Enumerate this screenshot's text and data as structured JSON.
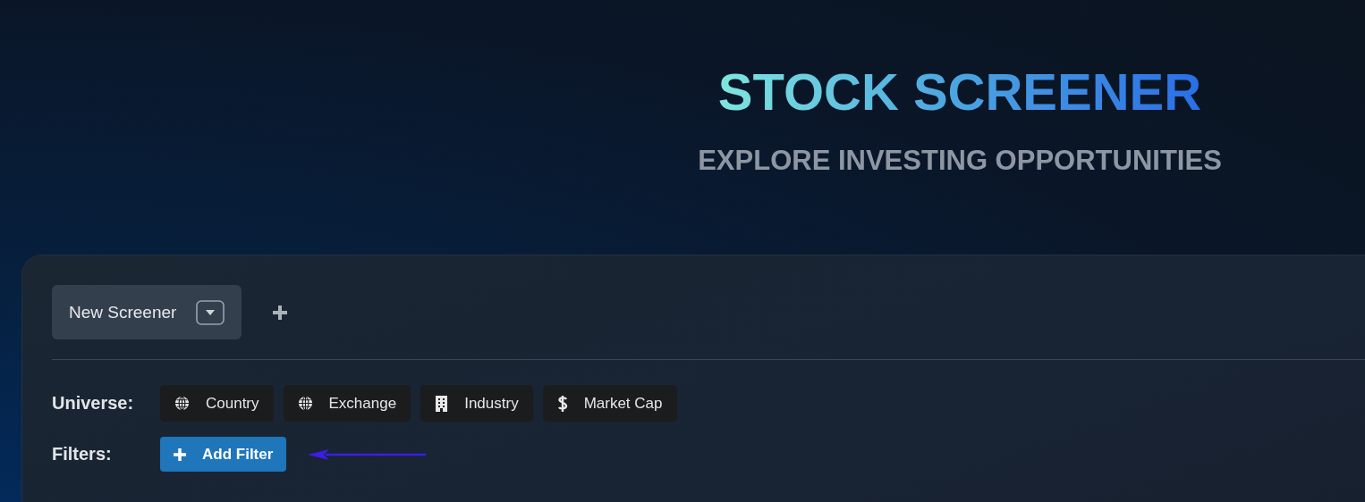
{
  "header": {
    "title": "STOCK SCREENER",
    "subtitle": "EXPLORE INVESTING OPPORTUNITIES"
  },
  "screener_tabs": [
    {
      "label": "New Screener",
      "selected": true
    }
  ],
  "universe": {
    "label": "Universe:",
    "items": [
      {
        "label": "Country",
        "kind": "globe"
      },
      {
        "label": "Exchange",
        "kind": "globe"
      },
      {
        "label": "Industry",
        "kind": "building"
      },
      {
        "label": "Market Cap",
        "kind": "dollar"
      }
    ]
  },
  "filters": {
    "label": "Filters:",
    "button": "Add Filter"
  }
}
